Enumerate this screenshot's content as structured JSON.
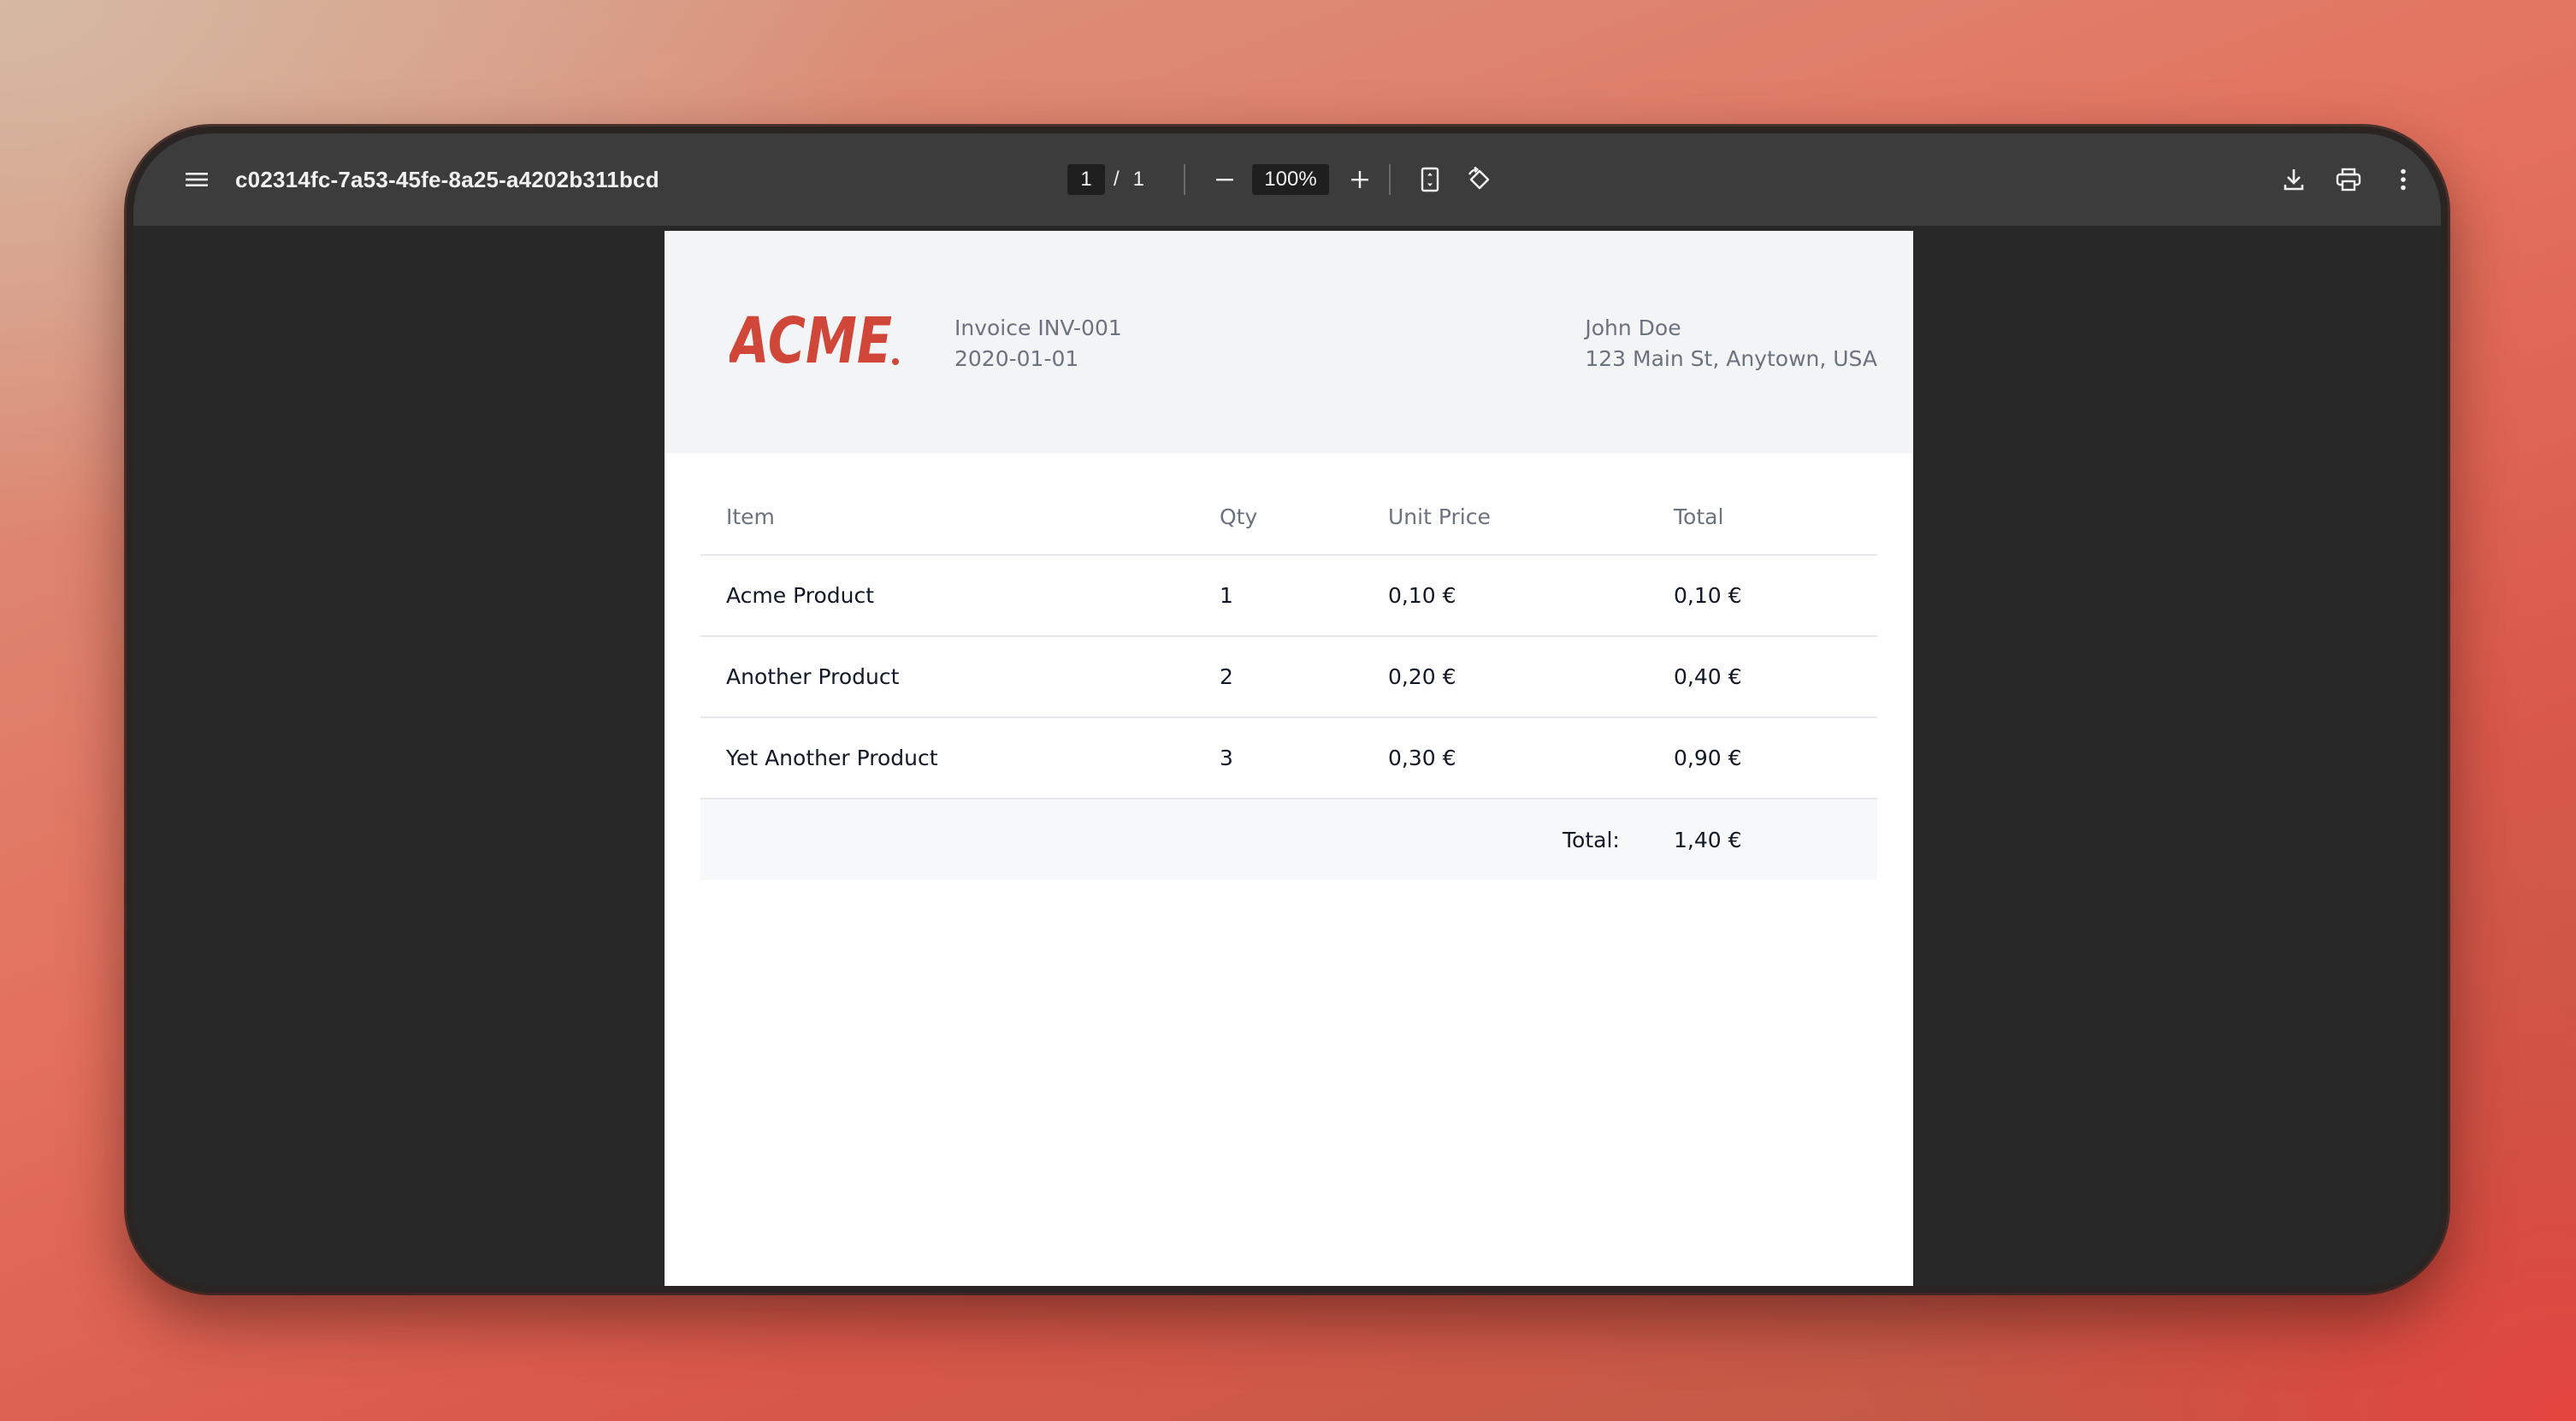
{
  "viewer": {
    "title": "c02314fc-7a53-45fe-8a25-a4202b311bcd",
    "current_page": "1",
    "page_separator": "/",
    "total_pages": "1",
    "zoom": "100%",
    "icons": {
      "menu": "menu-icon",
      "zoom_out": "minus-icon",
      "zoom_in": "plus-icon",
      "fit": "fit-page-icon",
      "rotate": "rotate-icon",
      "download": "download-icon",
      "print": "print-icon",
      "more": "more-vert-icon"
    }
  },
  "invoice": {
    "logo_text": "ACME",
    "logo_color": "#d0473a",
    "number": "Invoice INV-001",
    "date": "2020-01-01",
    "customer_name": "John Doe",
    "customer_address": "123 Main St, Anytown, USA",
    "columns": [
      "Item",
      "Qty",
      "Unit Price",
      "Total"
    ],
    "rows": [
      {
        "item": "Acme Product",
        "qty": "1",
        "unit_price": "0,10 €",
        "total": "0,10 €"
      },
      {
        "item": "Another Product",
        "qty": "2",
        "unit_price": "0,20 €",
        "total": "0,40 €"
      },
      {
        "item": "Yet Another Product",
        "qty": "3",
        "unit_price": "0,30 €",
        "total": "0,90 €"
      }
    ],
    "total_label": "Total:",
    "total_value": "1,40 €"
  }
}
